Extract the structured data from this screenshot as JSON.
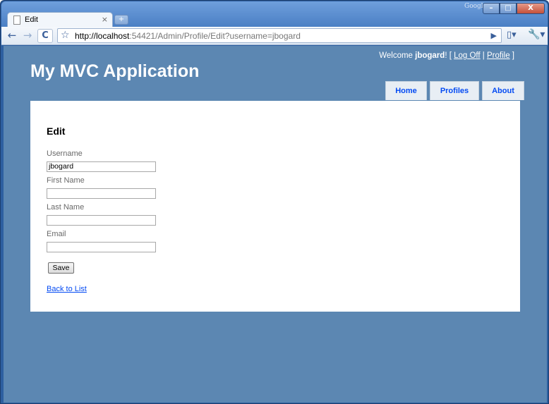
{
  "browser": {
    "google_mark": "Google",
    "tab_title": "Edit",
    "tab_close": "×",
    "new_tab_label": "+",
    "url_host": "http://localhost",
    "url_rest": ":54421/Admin/Profile/Edit?username=jbogard",
    "back_icon": "←",
    "forward_icon": "→",
    "reload_icon": "C",
    "star_icon": "☆",
    "go_icon": "▶",
    "page_menu_icon": "▯▾",
    "wrench_icon": "🔧▾",
    "min_icon": "–",
    "max_icon": "□",
    "close_icon": "X"
  },
  "header": {
    "welcome_prefix": "Welcome ",
    "username": "jbogard",
    "welcome_suffix": "! [ ",
    "logoff": "Log Off",
    "separator": " | ",
    "profile": "Profile",
    "bracket_close": " ]",
    "app_title": "My MVC Application"
  },
  "menu": {
    "items": [
      {
        "label": "Home"
      },
      {
        "label": "Profiles"
      },
      {
        "label": "About"
      }
    ]
  },
  "form": {
    "heading": "Edit",
    "fields": [
      {
        "label": "Username",
        "value": "jbogard"
      },
      {
        "label": "First Name",
        "value": ""
      },
      {
        "label": "Last Name",
        "value": ""
      },
      {
        "label": "Email",
        "value": ""
      }
    ],
    "save_label": "Save",
    "back_link": "Back to List"
  },
  "colors": {
    "page_background": "#5c87b2",
    "link": "#034af3"
  }
}
